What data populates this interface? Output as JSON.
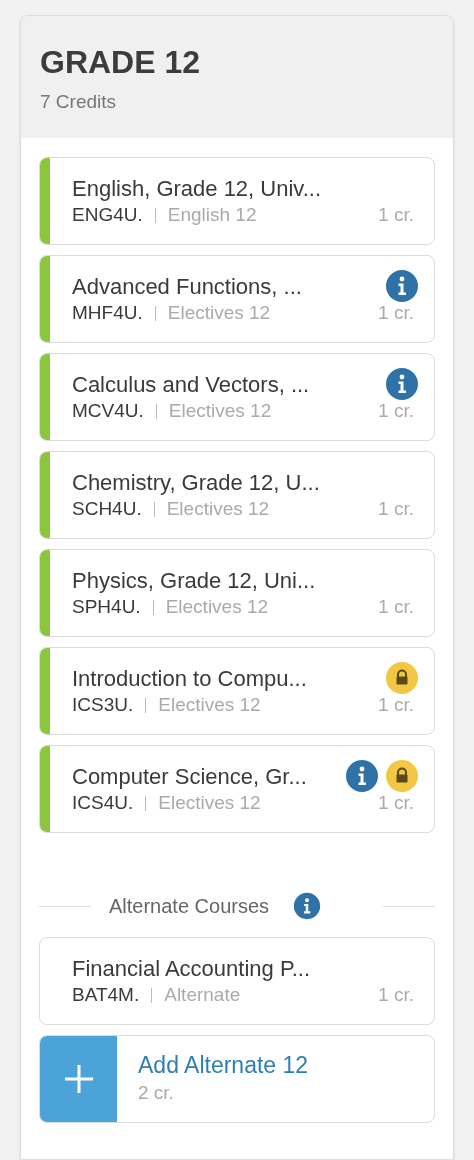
{
  "header": {
    "title": "GRADE 12",
    "credits": "7 Credits"
  },
  "courses": [
    {
      "title": "English, Grade 12, Univ...",
      "code": "ENG4U.",
      "category": "English 12",
      "credit": "1 cr.",
      "info": false,
      "locked": false
    },
    {
      "title": "Advanced Functions, ...",
      "code": "MHF4U.",
      "category": "Electives 12",
      "credit": "1 cr.",
      "info": true,
      "locked": false
    },
    {
      "title": "Calculus and Vectors, ...",
      "code": "MCV4U.",
      "category": "Electives 12",
      "credit": "1 cr.",
      "info": true,
      "locked": false
    },
    {
      "title": "Chemistry, Grade 12, U...",
      "code": "SCH4U.",
      "category": "Electives 12",
      "credit": "1 cr.",
      "info": false,
      "locked": false
    },
    {
      "title": "Physics, Grade 12, Uni...",
      "code": "SPH4U.",
      "category": "Electives 12",
      "credit": "1 cr.",
      "info": false,
      "locked": false
    },
    {
      "title": "Introduction to Compu...",
      "code": "ICS3U.",
      "category": "Electives 12",
      "credit": "1 cr.",
      "info": false,
      "locked": true
    },
    {
      "title": "Computer Science, Gr...",
      "code": "ICS4U.",
      "category": "Electives 12",
      "credit": "1 cr.",
      "info": true,
      "locked": true
    }
  ],
  "alternates": {
    "heading": "Alternate Courses",
    "info": true,
    "courses": [
      {
        "title": "Financial Accounting P...",
        "code": "BAT4M.",
        "category": "Alternate",
        "credit": "1 cr."
      }
    ],
    "add": {
      "label": "Add Alternate 12",
      "credit": "2 cr."
    }
  }
}
